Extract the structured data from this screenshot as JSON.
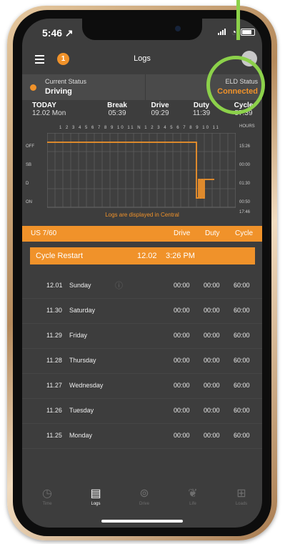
{
  "status_bar": {
    "time": "5:46 ↗"
  },
  "app": {
    "menu_icon": "hamburger-icon",
    "badge_count": "1",
    "title": "Logs",
    "settings_icon": "chevron-down-icon"
  },
  "current_status": {
    "label": "Current Status",
    "value": "Driving"
  },
  "eld_status": {
    "label": "ELD Status",
    "value": "Connected"
  },
  "summary": {
    "today_label": "TODAY",
    "today_date": "12.02 Mon",
    "columns": [
      {
        "label": "Break",
        "value": "05:39"
      },
      {
        "label": "Drive",
        "value": "09:29"
      },
      {
        "label": "Duty",
        "value": "11:39"
      },
      {
        "label": "Cycle",
        "value": "57:39"
      }
    ]
  },
  "chart": {
    "hour_axis": "1 2 3 4 5 6 7 8 9 10 11 N 1 2 3 4 5 6 7 8 9 10 11",
    "hours_label": "HOURS",
    "rows": [
      {
        "label": "OFF",
        "total": "15:26"
      },
      {
        "label": "SB",
        "total": "00:00"
      },
      {
        "label": "D",
        "total": "01:30"
      },
      {
        "label": "ON",
        "total": "00:50"
      }
    ],
    "grand_total": "17:46",
    "note": "Logs are displayed in Central"
  },
  "table_header": {
    "rule": "US 7/60",
    "drive": "Drive",
    "duty": "Duty",
    "cycle": "Cycle"
  },
  "cycle_restart": {
    "label": "Cycle Restart",
    "date": "12.02",
    "time": "3:26 PM"
  },
  "days": [
    {
      "date": "12.01",
      "day": "Sunday",
      "drive": "00:00",
      "duty": "00:00",
      "cycle": "60:00",
      "info": "ⓘ"
    },
    {
      "date": "11.30",
      "day": "Saturday",
      "drive": "00:00",
      "duty": "00:00",
      "cycle": "60:00"
    },
    {
      "date": "11.29",
      "day": "Friday",
      "drive": "00:00",
      "duty": "00:00",
      "cycle": "60:00"
    },
    {
      "date": "11.28",
      "day": "Thursday",
      "drive": "00:00",
      "duty": "00:00",
      "cycle": "60:00"
    },
    {
      "date": "11.27",
      "day": "Wednesday",
      "drive": "00:00",
      "duty": "00:00",
      "cycle": "60:00"
    },
    {
      "date": "11.26",
      "day": "Tuesday",
      "drive": "00:00",
      "duty": "00:00",
      "cycle": "60:00"
    },
    {
      "date": "11.25",
      "day": "Monday",
      "drive": "00:00",
      "duty": "00:00",
      "cycle": "60:00"
    }
  ],
  "tabs": [
    {
      "label": "Time",
      "icon": "clock-icon",
      "active": false
    },
    {
      "label": "Logs",
      "icon": "logs-icon",
      "active": true
    },
    {
      "label": "Drive",
      "icon": "map-pin-icon",
      "active": false
    },
    {
      "label": "Life",
      "icon": "leaf-icon",
      "active": false
    },
    {
      "label": "Loads",
      "icon": "loads-icon",
      "active": false
    }
  ],
  "colors": {
    "accent": "#f0922a",
    "highlight_ring": "#8cd14a",
    "background": "#3d3d3d"
  }
}
